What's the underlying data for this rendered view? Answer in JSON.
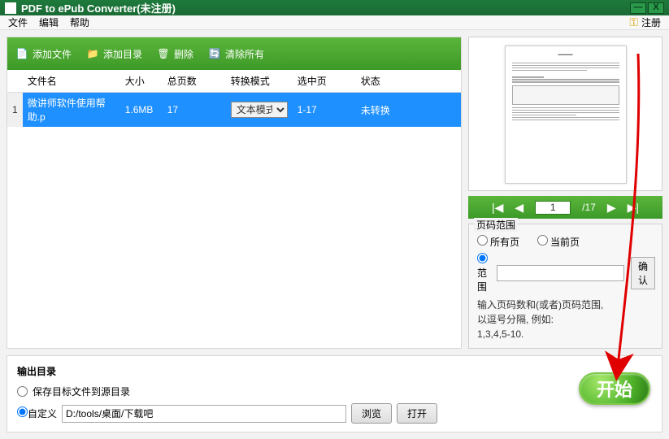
{
  "titlebar": {
    "title": "PDF to ePub Converter(未注册)"
  },
  "menubar": {
    "file": "文件",
    "edit": "编辑",
    "help": "帮助",
    "register": "注册"
  },
  "toolbar": {
    "add_file": "添加文件",
    "add_dir": "添加目录",
    "delete": "删除",
    "clear_all": "清除所有"
  },
  "table": {
    "headers": {
      "idx": "",
      "name": "文件名",
      "size": "大小",
      "pages": "总页数",
      "mode": "转换模式",
      "selpages": "选中页",
      "status": "状态"
    },
    "row": {
      "idx": "1",
      "name": "微讲师软件使用帮助.p",
      "size": "1.6MB",
      "pages": "17",
      "mode": "文本模式",
      "selpages": "1-17",
      "status": "未转换"
    }
  },
  "pager": {
    "current": "1",
    "total": "/17"
  },
  "range": {
    "legend": "页码范围",
    "all": "所有页",
    "current": "当前页",
    "range": "范围",
    "ok": "确认",
    "hint1": "输入页码数和(或者)页码范围,",
    "hint2": "以逗号分隔, 例如:",
    "hint3": "1,3,4,5-10."
  },
  "output": {
    "title": "输出目录",
    "same_dir": "保存目标文件到源目录",
    "custom": "自定义",
    "path": "D:/tools/桌面/下载吧",
    "browse": "浏览",
    "open": "打开"
  },
  "start": "开始"
}
